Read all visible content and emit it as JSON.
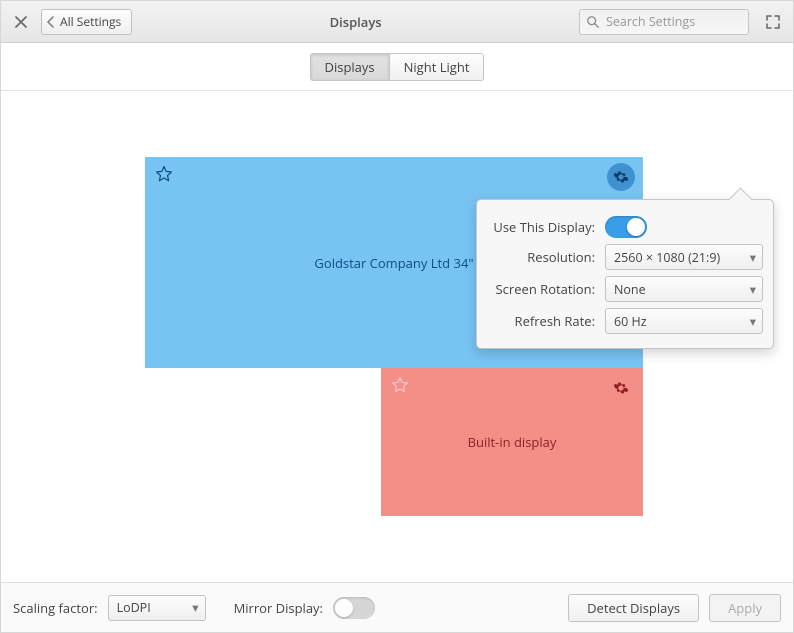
{
  "header": {
    "back_label": "All Settings",
    "title": "Displays",
    "search_placeholder": "Search Settings"
  },
  "tabs": {
    "displays_label": "Displays",
    "night_light_label": "Night Light",
    "active": "displays"
  },
  "monitors": {
    "primary": {
      "name": "Goldstar Company Ltd 34\""
    },
    "secondary": {
      "name": "Built-in display"
    }
  },
  "popover": {
    "use_this_display_label": "Use This Display:",
    "use_this_display_on": true,
    "resolution_label": "Resolution:",
    "resolution_value": "2560 × 1080 (21:9)",
    "rotation_label": "Screen Rotation:",
    "rotation_value": "None",
    "refresh_label": "Refresh Rate:",
    "refresh_value": "60 Hz"
  },
  "footer": {
    "scaling_label": "Scaling factor:",
    "scaling_value": "LoDPI",
    "mirror_label": "Mirror Display:",
    "mirror_on": false,
    "detect_label": "Detect Displays",
    "apply_label": "Apply"
  }
}
